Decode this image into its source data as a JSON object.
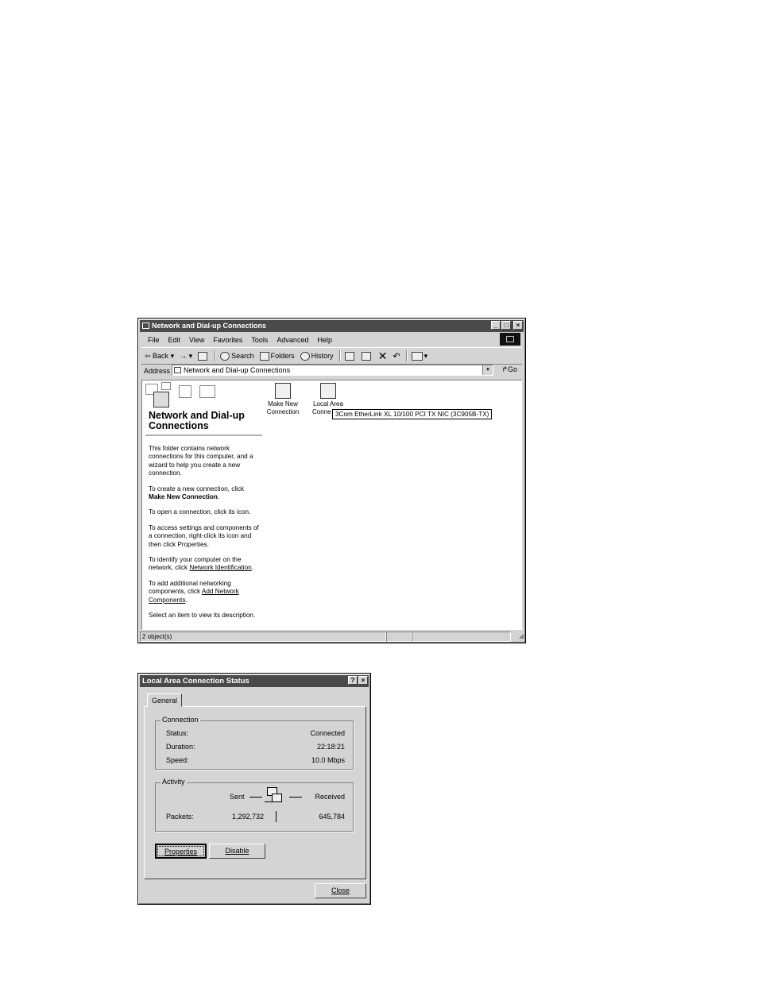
{
  "explorer": {
    "title": "Network and Dial-up Connections",
    "caption_buttons": {
      "minimize": "_",
      "maximize": "□",
      "close": "×"
    },
    "menu": [
      "File",
      "Edit",
      "View",
      "Favorites",
      "Tools",
      "Advanced",
      "Help"
    ],
    "toolbar": {
      "back": "Back",
      "forward": "→",
      "search": "Search",
      "folders": "Folders",
      "history": "History"
    },
    "address": {
      "label": "Address",
      "value": "Network and Dial-up Connections",
      "go": "Go",
      "dropdown_arrow": "▾"
    },
    "sidebar": {
      "title": "Network and Dial-up Connections",
      "p1": "This folder contains network connections for this computer, and a wizard to help you create a new connection.",
      "p2_pre": "To create a new connection, click ",
      "p2_bold": "Make New Connection",
      "p2_post": ".",
      "p3": "To open a connection, click its icon.",
      "p4": "To access settings and components of a connection, right-click its icon and then click Properties.",
      "p5_pre": "To identify your computer on the network, click ",
      "p5_link": "Network Identification",
      "p5_post": ".",
      "p6_pre": "To add additional networking components, click ",
      "p6_link": "Add Network Components",
      "p6_post": ".",
      "p7": "Select an item to view its description."
    },
    "icons": [
      {
        "label_line1": "Make New",
        "label_line2": "Connection"
      },
      {
        "label_line1": "Local Area",
        "label_line2": "Conne"
      }
    ],
    "tooltip": "3Com EtherLink XL 10/100 PCI TX NIC (3C905B-TX)",
    "status": "2 object(s)"
  },
  "dialog": {
    "title": "Local Area Connection Status",
    "help_btn": "?",
    "close_x": "×",
    "tab": "General",
    "connection": {
      "legend": "Connection",
      "status_label": "Status:",
      "status_value": "Connected",
      "duration_label": "Duration:",
      "duration_value": "22:18:21",
      "speed_label": "Speed:",
      "speed_value": "10.0 Mbps"
    },
    "activity": {
      "legend": "Activity",
      "sent": "Sent",
      "received": "Received",
      "packets_label": "Packets:",
      "packets_sent": "1,292,732",
      "packets_received": "645,784"
    },
    "buttons": {
      "properties": "Properties",
      "disable": "Disable",
      "close": "Close"
    }
  }
}
